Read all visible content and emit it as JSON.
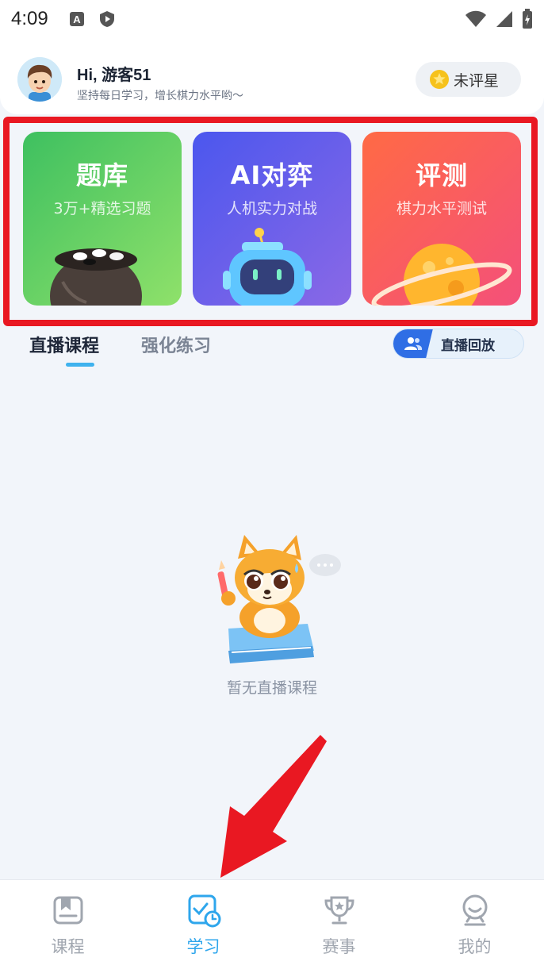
{
  "status_bar": {
    "time": "4:09"
  },
  "header": {
    "greeting": "Hi, 游客51",
    "motto": "坚持每日学习，增长棋力水平哟～",
    "star_badge": "未评星"
  },
  "cards": [
    {
      "title": "题库",
      "subtitle": "3万+精选习题",
      "icon": "go-stone-bowl"
    },
    {
      "title": "AI对弈",
      "subtitle": "人机实力对战",
      "icon": "robot"
    },
    {
      "title": "评测",
      "subtitle": "棋力水平测试",
      "icon": "planet"
    }
  ],
  "tabs": [
    {
      "label": "直播课程",
      "active": true
    },
    {
      "label": "强化练习",
      "active": false
    }
  ],
  "replay_button": {
    "label": "直播回放"
  },
  "empty_state": {
    "text": "暂无直播课程",
    "illustration": "fox-mascot-with-book"
  },
  "bottom_nav": [
    {
      "label": "课程",
      "icon": "course-icon",
      "active": false
    },
    {
      "label": "学习",
      "icon": "study-icon",
      "active": true
    },
    {
      "label": "赛事",
      "icon": "trophy-icon",
      "active": false
    },
    {
      "label": "我的",
      "icon": "profile-icon",
      "active": false
    }
  ],
  "colors": {
    "accent": "#2ea6ec",
    "highlight_border": "#e91822",
    "arrow": "#e91822"
  }
}
